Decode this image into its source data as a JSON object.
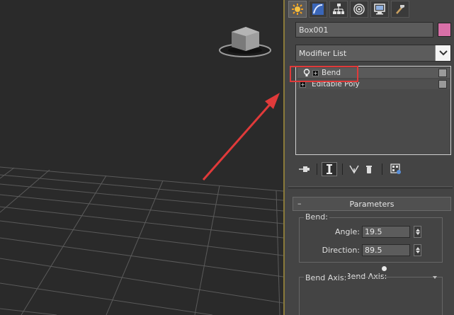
{
  "object_name": "Box001",
  "colors": {
    "object_color": "#d870a8",
    "highlight_box": "#e03a3a",
    "annotation_arrow": "#e03a3a",
    "panel_bg": "#444444"
  },
  "command_tabs": [
    {
      "icon": "create-icon",
      "active": true
    },
    {
      "icon": "modify-icon",
      "active": false
    },
    {
      "icon": "hierarchy-icon",
      "active": false
    },
    {
      "icon": "motion-icon",
      "active": false
    },
    {
      "icon": "display-icon",
      "active": false
    },
    {
      "icon": "utilities-icon",
      "active": false
    }
  ],
  "modifier_list": {
    "label": "Modifier List"
  },
  "modifier_stack": [
    {
      "name": "Bend",
      "icon": "lightbulb-icon",
      "expand": "+"
    },
    {
      "name": "Editable Poly",
      "expand": "+"
    }
  ],
  "stack_tools": [
    {
      "icon": "pin-stack-icon"
    },
    {
      "icon": "show-end-result-icon"
    },
    {
      "icon": "make-unique-icon"
    },
    {
      "icon": "remove-modifier-icon"
    },
    {
      "icon": "configure-modifier-sets-icon"
    }
  ],
  "parameters": {
    "title": "Parameters",
    "toggle": "–",
    "bend_group": "Bend:",
    "angle_label": "Angle:",
    "angle_value": "19.5",
    "direction_label": "Direction:",
    "direction_value": "89.5",
    "bend_axis_label": "Bend Axis:",
    "bend_axis_ghost": "Bend Axis:"
  }
}
